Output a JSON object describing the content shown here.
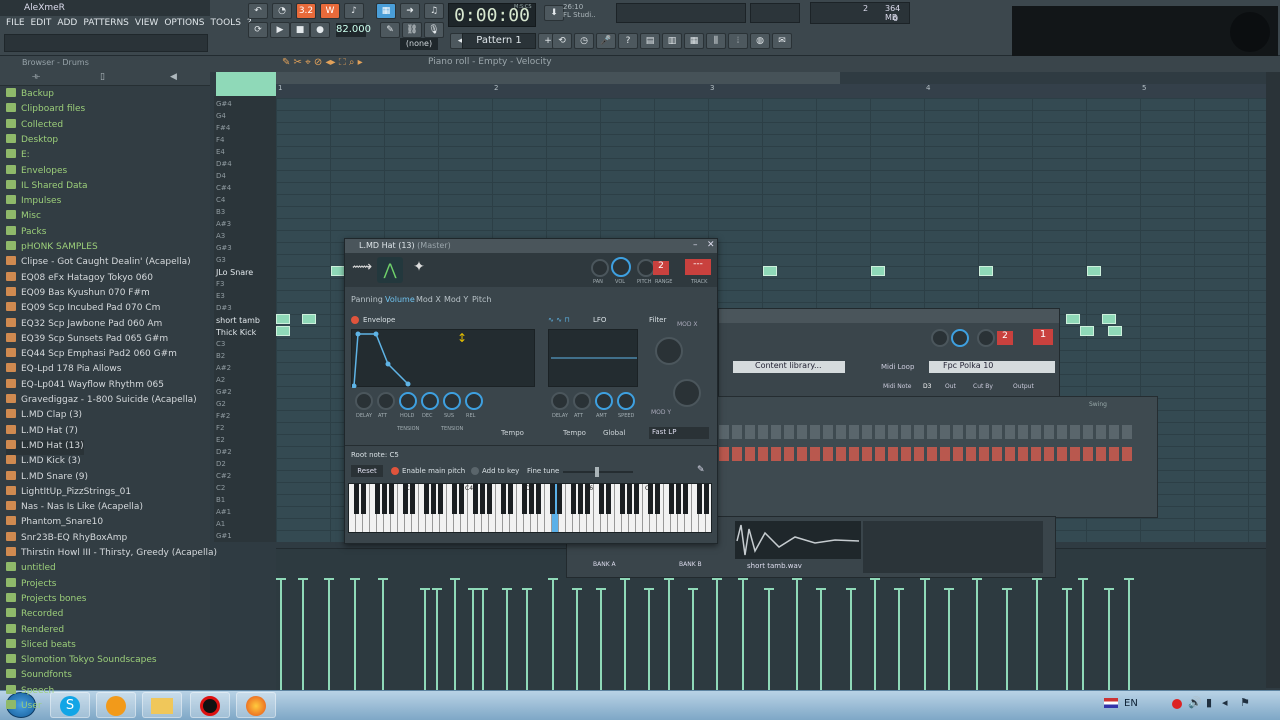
{
  "app": {
    "user": "AleXmeR"
  },
  "menu": [
    "FILE",
    "EDIT",
    "ADD",
    "PATTERNS",
    "VIEW",
    "OPTIONS",
    "TOOLS",
    "?"
  ],
  "transport": {
    "time": "0:00:00",
    "time_label": "M:S:CS",
    "tempo": "82.000",
    "pattern": "Pattern 1",
    "snap": "(none)",
    "song_counter": "26:10",
    "song_name": "FL Studi..",
    "mem": "364 MB",
    "cpu_count": "2",
    "poly": "0",
    "btn_pat": "3.2",
    "btn_w": "W"
  },
  "browser": {
    "title": "Browser - Drums",
    "items": [
      {
        "t": "folder",
        "label": "Backup"
      },
      {
        "t": "folder",
        "label": "Clipboard files"
      },
      {
        "t": "folder",
        "label": "Collected"
      },
      {
        "t": "folder",
        "label": "Desktop"
      },
      {
        "t": "folder",
        "label": "E:"
      },
      {
        "t": "folder",
        "label": "Envelopes"
      },
      {
        "t": "folder",
        "label": "IL Shared Data"
      },
      {
        "t": "folder",
        "label": "Impulses"
      },
      {
        "t": "folder",
        "label": "Misc"
      },
      {
        "t": "folder",
        "label": "Packs"
      },
      {
        "t": "folder",
        "label": "pHONK SAMPLES"
      },
      {
        "t": "file",
        "label": "Clipse - Got Caught Dealin' (Acapella)"
      },
      {
        "t": "file",
        "label": "EQ08 eFx Hatagoy Tokyo 060"
      },
      {
        "t": "file",
        "label": "EQ09 Bas Kyushun 070 F#m"
      },
      {
        "t": "file",
        "label": "EQ09 Scp Incubed Pad 070 Cm"
      },
      {
        "t": "file",
        "label": "EQ32 Scp Jawbone Pad 060 Am"
      },
      {
        "t": "file",
        "label": "EQ39 Scp Sunsets Pad 065 G#m"
      },
      {
        "t": "file",
        "label": "EQ44 Scp Emphasi Pad2 060 G#m"
      },
      {
        "t": "file",
        "label": "EQ-Lpd 178 Pia Allows"
      },
      {
        "t": "file",
        "label": "EQ-Lp041 Wayflow Rhythm 065"
      },
      {
        "t": "file",
        "label": "Gravediggaz - 1-800 Suicide (Acapella)"
      },
      {
        "t": "file",
        "label": "L.MD Clap (3)"
      },
      {
        "t": "file",
        "label": "L.MD Hat (7)"
      },
      {
        "t": "file",
        "label": "L.MD Hat (13)"
      },
      {
        "t": "file",
        "label": "L.MD Kick (3)"
      },
      {
        "t": "file",
        "label": "L.MD Snare (9)"
      },
      {
        "t": "file",
        "label": "LightItUp_PizzStrings_01"
      },
      {
        "t": "file",
        "label": "Nas - Nas Is Like (Acapella)"
      },
      {
        "t": "file",
        "label": "Phantom_Snare10"
      },
      {
        "t": "file",
        "label": "Snr23B-EQ RhyBoxAmp"
      },
      {
        "t": "file",
        "label": "Thirstin Howl III - Thirsty, Greedy (Acapella)"
      },
      {
        "t": "folder",
        "label": "untitled"
      },
      {
        "t": "folder",
        "label": "Projects"
      },
      {
        "t": "folder",
        "label": "Projects bones"
      },
      {
        "t": "folder",
        "label": "Recorded"
      },
      {
        "t": "folder",
        "label": "Rendered"
      },
      {
        "t": "folder",
        "label": "Sliced beats"
      },
      {
        "t": "folder",
        "label": "Slomotion Tokyo Soundscapes"
      },
      {
        "t": "folder",
        "label": "Soundfonts"
      },
      {
        "t": "folder",
        "label": "Speech"
      },
      {
        "t": "folder",
        "label": "User"
      }
    ]
  },
  "pianoroll": {
    "title": "Piano roll - Empty - Velocity",
    "bars": [
      "1",
      "2",
      "3",
      "4",
      "5"
    ],
    "keys": [
      "G#4",
      "G4",
      "F#4",
      "F4",
      "E4",
      "D#4",
      "D4",
      "C#4",
      "C4",
      "B3",
      "A#3",
      "A3",
      "G#3",
      "G3",
      "JLo Snare",
      "F3",
      "E3",
      "D#3",
      "short tamb",
      "Thick Kick",
      "C3",
      "B2",
      "A#2",
      "A2",
      "G#2",
      "G2",
      "F#2",
      "F2",
      "E2",
      "D#2",
      "D2",
      "C#2",
      "C2",
      "B1",
      "A#1",
      "A1",
      "G#1"
    ]
  },
  "plugin": {
    "title": "L.MD Hat (13)",
    "subtitle": "(Master)",
    "tabs": [
      "Panning",
      "Volume",
      "Mod X",
      "Mod Y",
      "Pitch"
    ],
    "active_tab": "Volume",
    "envelope_label": "Envelope",
    "lfo_label": "LFO",
    "filter_label": "Filter",
    "mod_x": "MOD X",
    "mod_y": "MOD Y",
    "env_knobs": [
      "DELAY",
      "ATT",
      "HOLD",
      "DEC",
      "SUS",
      "REL"
    ],
    "tension": "TENSION",
    "lfo_knobs": [
      "DELAY",
      "ATT",
      "AMT",
      "SPEED"
    ],
    "tempo": "Tempo",
    "global": "Global",
    "filter_type": "Fast LP",
    "root_note": "Root note: C5",
    "reset": "Reset",
    "enable_main_pitch": "Enable main pitch",
    "add_to_key": "Add to key",
    "fine_tune": "Fine tune",
    "top_knobs": [
      "PAN",
      "VOL",
      "PITCH",
      "RANGE",
      "TRACK"
    ],
    "range_val": "2",
    "track_val": "---",
    "octaves": [
      "C3",
      "C4",
      "C5",
      "C6",
      "C7"
    ]
  },
  "channel": {
    "content_library": "Content library...",
    "midi_loop": "Midi Loop",
    "preset": "Fpc Polka 10",
    "labels": [
      "Midi Note",
      "D3",
      "Out",
      "Cut By",
      "Output"
    ],
    "range_val": "2",
    "track_val": "1",
    "swing": "Swing"
  },
  "sampler": {
    "bank_a": "BANK A",
    "bank_b": "BANK B",
    "sample": "short tamb.wav"
  },
  "taskbar": {
    "lang": "EN"
  }
}
